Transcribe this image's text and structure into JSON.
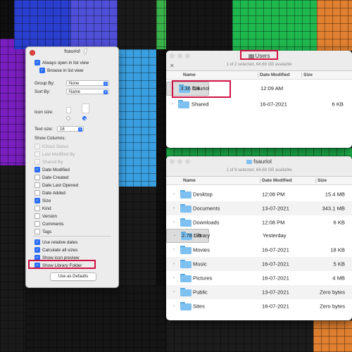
{
  "wallpaper": {
    "colors": [
      "#7a1fbf",
      "#d11fd9",
      "#2a3fcf",
      "#3a9fe0",
      "#1fb84f",
      "#3ab04a",
      "#e08030",
      "#0f0f0f"
    ]
  },
  "view_options_panel": {
    "title": "fsauriol",
    "always_open_in_list_view": {
      "label": "Always open in list view",
      "checked": true
    },
    "browse_in_list_view": {
      "label": "Browse in list view",
      "checked": true
    },
    "group_by": {
      "label": "Group By:",
      "value": "None"
    },
    "sort_by": {
      "label": "Sort By:",
      "value": "Name"
    },
    "icon_size_label": "Icon size:",
    "text_size": {
      "label": "Text size:",
      "value": "16"
    },
    "show_columns_label": "Show Columns:",
    "columns": [
      {
        "label": "iCloud Status",
        "checked": false,
        "disabled": true
      },
      {
        "label": "Last Modified By",
        "checked": false,
        "disabled": true
      },
      {
        "label": "Shared By",
        "checked": false,
        "disabled": true
      },
      {
        "label": "Date Modified",
        "checked": true,
        "disabled": false
      },
      {
        "label": "Date Created",
        "checked": false,
        "disabled": false
      },
      {
        "label": "Date Last Opened",
        "checked": false,
        "disabled": false
      },
      {
        "label": "Date Added",
        "checked": false,
        "disabled": false
      },
      {
        "label": "Size",
        "checked": true,
        "disabled": false
      },
      {
        "label": "Kind",
        "checked": false,
        "disabled": false
      },
      {
        "label": "Version",
        "checked": false,
        "disabled": false
      },
      {
        "label": "Comments",
        "checked": false,
        "disabled": false
      },
      {
        "label": "Tags",
        "checked": false,
        "disabled": false
      }
    ],
    "options": [
      {
        "label": "Use relative dates",
        "checked": true
      },
      {
        "label": "Calculate all sizes",
        "checked": true
      },
      {
        "label": "Show icon preview",
        "checked": true
      },
      {
        "label": "Show Library Folder",
        "checked": true
      }
    ],
    "defaults_button": "Use as Defaults"
  },
  "users_window": {
    "title": "Users",
    "subtitle": "1 of 2 selected, 64.68 GB available",
    "headers": {
      "name": "Name",
      "date": "Date Modified",
      "size": "Size"
    },
    "rows": [
      {
        "name": "fsauriol",
        "date": "12:09 AM",
        "size": "3.36 GB",
        "selected": true
      },
      {
        "name": "Shared",
        "date": "16-07-2021",
        "size": "6 KB",
        "selected": false
      }
    ]
  },
  "home_window": {
    "title": "fsauriol",
    "subtitle": "1 of 9 selected, 64.68 GB available",
    "headers": {
      "name": "Name",
      "date": "Date Modified",
      "size": "Size"
    },
    "rows": [
      {
        "name": "Desktop",
        "date": "12:08 PM",
        "size": "15.4 MB",
        "selected": false
      },
      {
        "name": "Documents",
        "date": "13-07-2021",
        "size": "343.1 MB",
        "selected": false
      },
      {
        "name": "Downloads",
        "date": "12:08 PM",
        "size": "6 KB",
        "selected": false
      },
      {
        "name": "Library",
        "date": "Yesterday",
        "size": "2.78 GB",
        "selected": true
      },
      {
        "name": "Movies",
        "date": "16-07-2021",
        "size": "18 KB",
        "selected": false
      },
      {
        "name": "Music",
        "date": "16-07-2021",
        "size": "5 KB",
        "selected": false
      },
      {
        "name": "Pictures",
        "date": "16-07-2021",
        "size": "4 MB",
        "selected": false
      },
      {
        "name": "Public",
        "date": "13-07-2021",
        "size": "Zero bytes",
        "selected": false
      },
      {
        "name": "Sites",
        "date": "16-07-2021",
        "size": "Zero bytes",
        "selected": false
      }
    ]
  }
}
